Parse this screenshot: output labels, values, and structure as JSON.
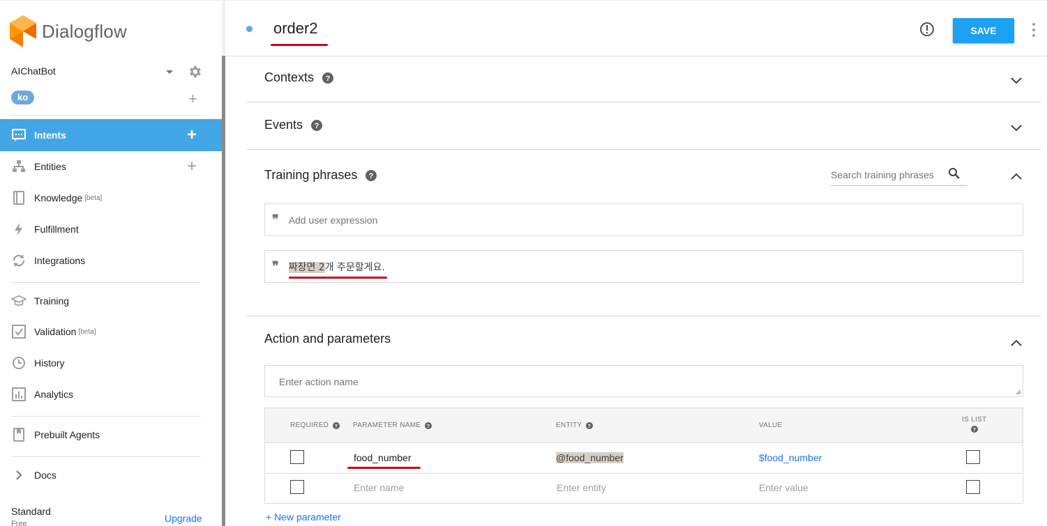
{
  "app": {
    "brand": "Dialogflow"
  },
  "agent": {
    "name": "AIChatBot",
    "language": "ko"
  },
  "nav": {
    "intents": "Intents",
    "entities": "Entities",
    "knowledge": "Knowledge",
    "knowledge_badge": "[beta]",
    "fulfillment": "Fulfillment",
    "integrations": "Integrations",
    "training": "Training",
    "validation": "Validation",
    "validation_badge": "[beta]",
    "history": "History",
    "analytics": "Analytics",
    "prebuilt_agents": "Prebuilt Agents",
    "docs": "Docs"
  },
  "plan": {
    "label": "Standard",
    "sub": "Free",
    "upgrade": "Upgrade"
  },
  "header": {
    "intent_name": "order2",
    "save_label": "SAVE"
  },
  "sections": {
    "contexts": "Contexts",
    "events": "Events",
    "training_phrases": "Training phrases",
    "action_parameters": "Action and parameters"
  },
  "training": {
    "search_placeholder": "Search training phrases",
    "add_placeholder": "Add user expression",
    "phrases": [
      {
        "highlighted": "짜장면 2",
        "rest": "개 주문할게요."
      }
    ]
  },
  "action": {
    "placeholder": "Enter action name"
  },
  "params": {
    "headers": {
      "required": "REQUIRED",
      "name": "PARAMETER NAME",
      "entity": "ENTITY",
      "value": "VALUE",
      "is_list": "IS LIST"
    },
    "rows": [
      {
        "name": "food_number",
        "entity": "@food_number",
        "value": "$food_number"
      }
    ],
    "empty_row": {
      "name": "Enter name",
      "entity": "Enter entity",
      "value": "Enter value"
    },
    "new_param": "+ New parameter"
  },
  "colors": {
    "accent": "#42a5e5",
    "save": "#1da1f2",
    "highlight": "#d8cfc7",
    "annotation": "#d0021b"
  }
}
